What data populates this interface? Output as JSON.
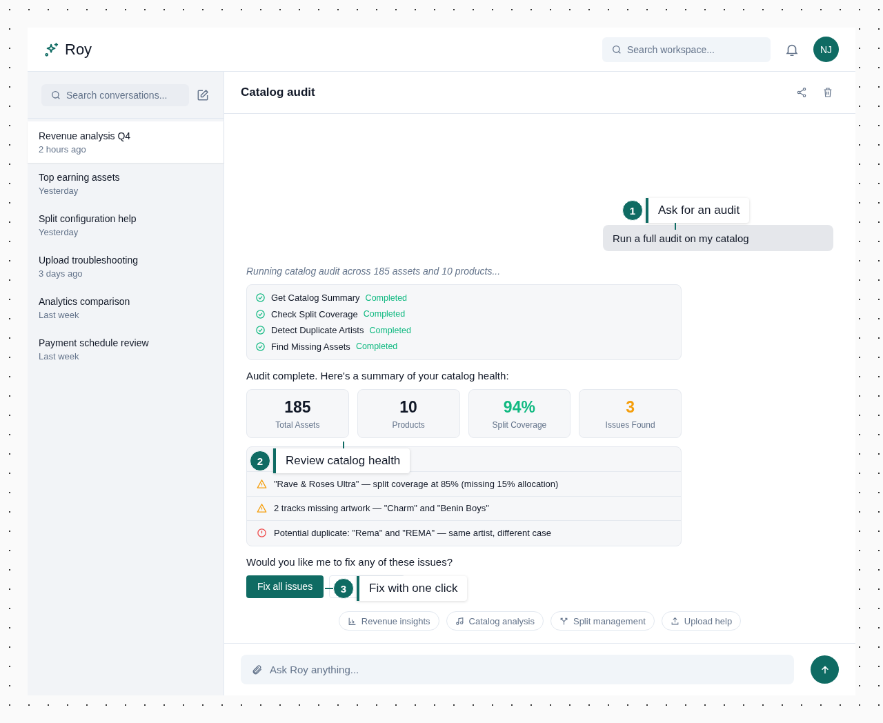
{
  "app": {
    "name": "Roy"
  },
  "header": {
    "search_placeholder": "Search workspace...",
    "avatar": "NJ"
  },
  "sidebar": {
    "search_placeholder": "Search conversations...",
    "items": [
      {
        "title": "Revenue analysis Q4",
        "time": "2 hours ago",
        "selected": true
      },
      {
        "title": "Top earning assets",
        "time": "Yesterday",
        "selected": false
      },
      {
        "title": "Split configuration help",
        "time": "Yesterday",
        "selected": false
      },
      {
        "title": "Upload troubleshooting",
        "time": "3 days ago",
        "selected": false
      },
      {
        "title": "Analytics comparison",
        "time": "Last week",
        "selected": false
      },
      {
        "title": "Payment schedule review",
        "time": "Last week",
        "selected": false
      }
    ]
  },
  "chat": {
    "title": "Catalog audit",
    "user_message": "Run a full audit on my catalog",
    "status_text": "Running catalog audit across 185 assets and 10 products...",
    "tools": [
      {
        "name": "Get Catalog Summary",
        "status": "Completed"
      },
      {
        "name": "Check Split Coverage",
        "status": "Completed"
      },
      {
        "name": "Detect Duplicate Artists",
        "status": "Completed"
      },
      {
        "name": "Find Missing Assets",
        "status": "Completed"
      }
    ],
    "summary_intro": "Audit complete. Here's a summary of your catalog health:",
    "stats": [
      {
        "value": "185",
        "label": "Total Assets",
        "color": "#111827"
      },
      {
        "value": "10",
        "label": "Products",
        "color": "#111827"
      },
      {
        "value": "94%",
        "label": "Split Coverage",
        "color": "#10b981"
      },
      {
        "value": "3",
        "label": "Issues Found",
        "color": "#f59e0b"
      }
    ],
    "issues": [
      {
        "kind": "warning",
        "text": "\"Rave & Roses Ultra\" — split coverage at 85% (missing 15% allocation)"
      },
      {
        "kind": "warning",
        "text": "2 tracks missing artwork — \"Charm\" and \"Benin Boys\""
      },
      {
        "kind": "error",
        "text": "Potential duplicate: \"Rema\" and \"REMA\" — same artist, different case"
      }
    ],
    "question": "Would you like me to fix any of these issues?",
    "primary_button": "Fix all issues"
  },
  "suggestions": [
    {
      "kind": "chart",
      "label": "Revenue insights"
    },
    {
      "kind": "music",
      "label": "Catalog analysis"
    },
    {
      "kind": "split",
      "label": "Split management"
    },
    {
      "kind": "upload",
      "label": "Upload help"
    }
  ],
  "composer": {
    "placeholder": "Ask Roy anything..."
  },
  "callouts": [
    {
      "number": "1",
      "label": "Ask for an audit"
    },
    {
      "number": "2",
      "label": "Review catalog health"
    },
    {
      "number": "3",
      "label": "Fix with one click"
    }
  ]
}
